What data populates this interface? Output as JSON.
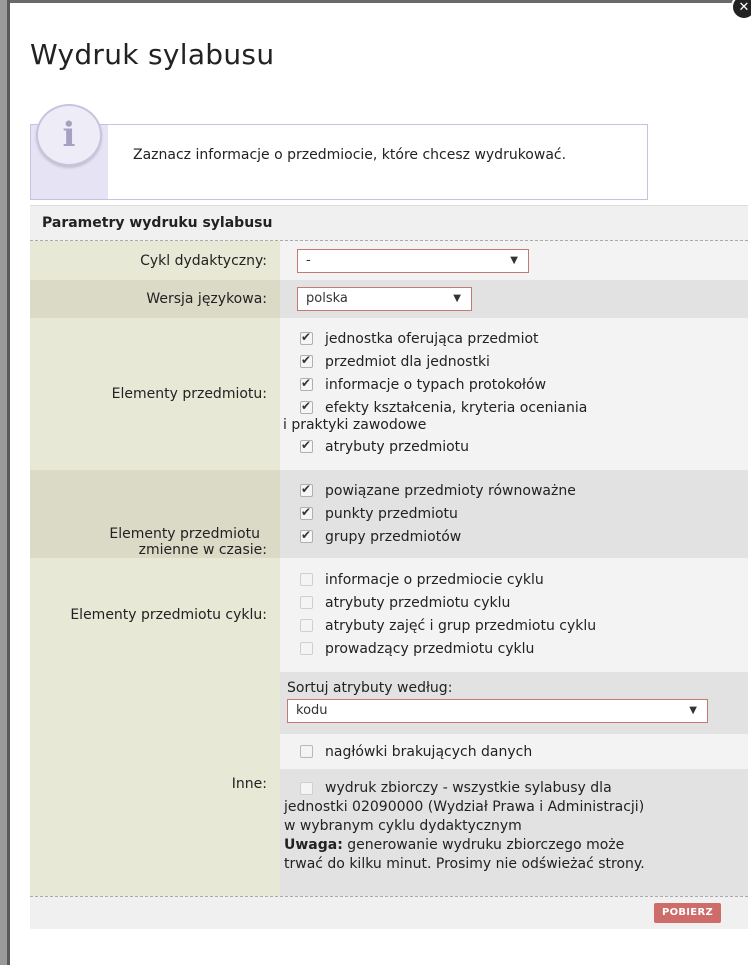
{
  "dialog": {
    "title": "Wydruk sylabusu",
    "close_icon": "close-icon"
  },
  "info": {
    "icon": "info-icon",
    "text": "Zaznacz informacje o przedmiocie, które chcesz wydrukować."
  },
  "panel": {
    "header": "Parametry wydruku sylabusu",
    "cycle": {
      "label": "Cykl dydaktyczny:",
      "value": "-"
    },
    "language": {
      "label": "Wersja językowa:",
      "value": "polska"
    },
    "elements": {
      "label": "Elementy przedmiotu:",
      "items": [
        {
          "label": "jednostka oferująca przedmiot",
          "checked": true
        },
        {
          "label": "przedmiot dla jednostki",
          "checked": true
        },
        {
          "label": "informacje o typach protokołów",
          "checked": true
        },
        {
          "label": "efekty kształcenia, kryteria oceniania",
          "label2": "i praktyki zawodowe",
          "checked": true
        },
        {
          "label": "atrybuty przedmiotu",
          "checked": true
        }
      ]
    },
    "time_elements": {
      "label_line1": "Elementy przedmiotu",
      "label_line2": "zmienne w czasie:",
      "items": [
        {
          "label": "powiązane przedmioty równoważne",
          "checked": true
        },
        {
          "label": "punkty przedmiotu",
          "checked": true
        },
        {
          "label": "grupy przedmiotów",
          "checked": true
        }
      ]
    },
    "cycle_elements": {
      "label": "Elementy przedmiotu cyklu:",
      "items": [
        {
          "label": "informacje o przedmiocie cyklu",
          "checked": false
        },
        {
          "label": "atrybuty przedmiotu cyklu",
          "checked": false
        },
        {
          "label": "atrybuty zajęć i grup przedmiotu cyklu",
          "checked": false
        },
        {
          "label": "prowadzący przedmiotu cyklu",
          "checked": false
        }
      ]
    },
    "other": {
      "label": "Inne:",
      "sort_label": "Sortuj atrybuty według:",
      "sort_value": "kodu",
      "missing_headers": "nagłówki brakujących danych",
      "summary_line1": "wydruk zbiorczy - wszystkie sylabusy dla",
      "summary_line2": "jednostki 02090000 (Wydział Prawa i Administracji)",
      "summary_line3": "w wybranym cyklu dydaktycznym",
      "warning_bold": "Uwaga:",
      "warning_line1": " generowanie wydruku zbiorczego może",
      "warning_line2": "trwać do kilku minut. Prosimy nie odświeżać strony."
    },
    "submit": "POBIERZ"
  }
}
